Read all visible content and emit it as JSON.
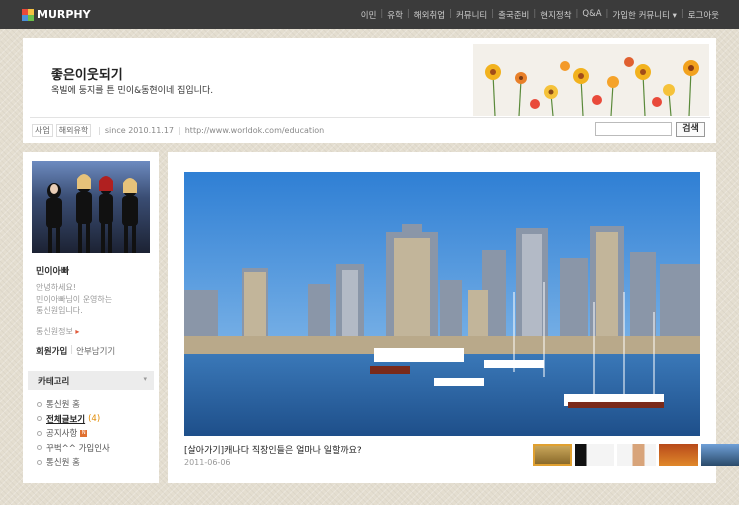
{
  "topbar": {
    "logo": "MURPHY",
    "nav": [
      "이민",
      "유학",
      "해외취업",
      "커뮤니티",
      "출국준비",
      "현지정착",
      "Q&A",
      "가입한 커뮤니티 ▾",
      "로그아웃"
    ]
  },
  "header": {
    "title": "좋은이웃되기",
    "description": "옥빌에 둥지를 튼 민이&동현이네 집입니다.",
    "tags": [
      "사업",
      "해외유학"
    ],
    "since": "since 2010.11.17",
    "url": "http://www.worldok.com/education",
    "search_placeholder": "",
    "search_button": "검색"
  },
  "sidebar": {
    "nickname": "민이아빠",
    "intro": "안녕하세요!\n민이아빠님이 운영하는\n통신원입니다.",
    "info_link": "통신원정보",
    "info_arrow": "▸",
    "join": "회원가입",
    "guest": "안부남기기",
    "category_title": "카테고리",
    "category_arrow": "▾",
    "categories": [
      {
        "name": "통신원 홈"
      },
      {
        "name": "전체글보기",
        "count": "(4)"
      },
      {
        "name": "공지사항",
        "badge": "N"
      },
      {
        "name": "꾸벅^^ 가입인사"
      },
      {
        "name": "통신원 홈"
      }
    ]
  },
  "post": {
    "title": "[살아가기]캐나다 직장인들은 얼마나 일할까요?",
    "date": "2011-06-06"
  },
  "colors": {
    "topbar": "#3b3b3b",
    "count": "#e08a00",
    "thumb_active_border": "#e0a030"
  }
}
